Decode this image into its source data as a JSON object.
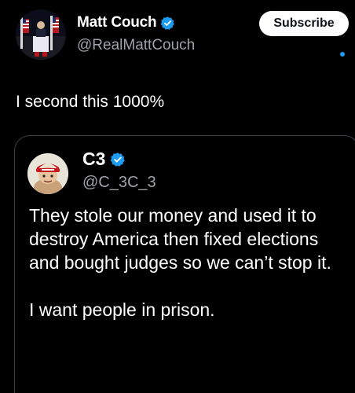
{
  "tweet": {
    "author": {
      "name": "Matt Couch",
      "handle": "@RealMattCouch",
      "verified": true
    },
    "subscribe_label": "Subscribe",
    "text": "I second this 1000%"
  },
  "quoted_tweet": {
    "author": {
      "name": "C3",
      "handle": "@C_3C_3",
      "verified": true
    },
    "paragraphs": [
      "They stole our money and used it to destroy America then fixed elections and bought judges so we can’t stop it.",
      "I want people in prison."
    ]
  },
  "colors": {
    "background": "#000000",
    "text": "#ffffff",
    "secondary_text": "#9ea3a8",
    "verified_blue": "#1d9bf0",
    "card_border": "#3a3f44"
  }
}
